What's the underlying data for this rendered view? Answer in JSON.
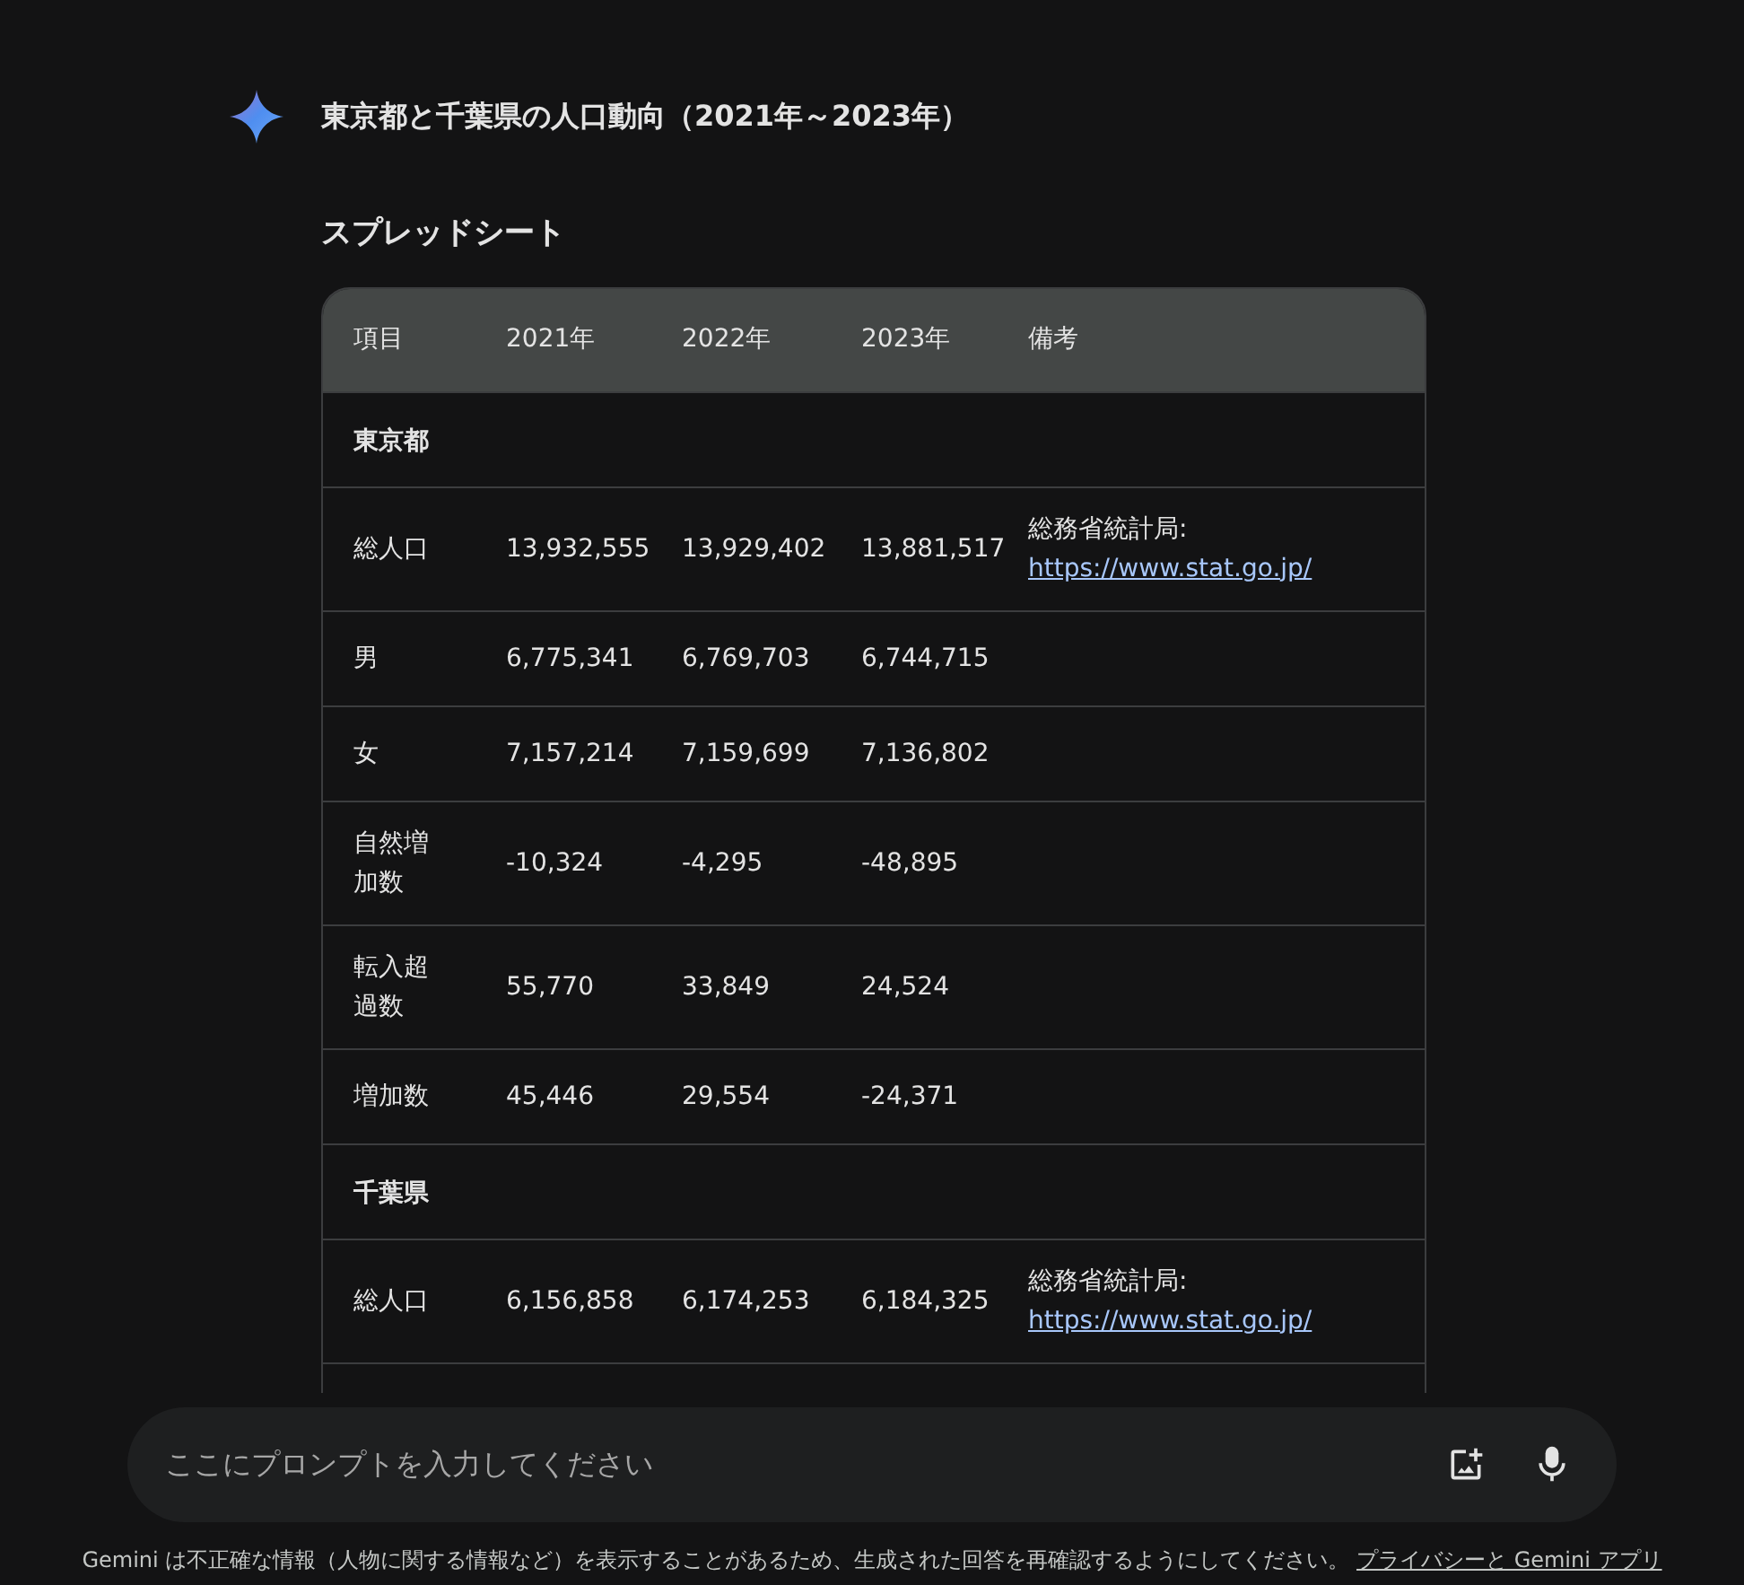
{
  "response": {
    "title": "東京都と千葉県の人口動向（2021年～2023年）",
    "section_heading": "スプレッドシート"
  },
  "table": {
    "columns": [
      "項目",
      "2021年",
      "2022年",
      "2023年",
      "備考"
    ],
    "rows": [
      {
        "kind": "section",
        "label": "東京都"
      },
      {
        "kind": "data",
        "label": "総人口",
        "values": [
          "13,932,555",
          "13,929,402",
          "13,881,517"
        ],
        "note": "総務省統計局:",
        "link": "https://www.stat.go.jp/"
      },
      {
        "kind": "data",
        "label": "男",
        "values": [
          "6,775,341",
          "6,769,703",
          "6,744,715"
        ]
      },
      {
        "kind": "data",
        "label": "女",
        "values": [
          "7,157,214",
          "7,159,699",
          "7,136,802"
        ]
      },
      {
        "kind": "data",
        "label": "自然増加数",
        "values": [
          "-10,324",
          "-4,295",
          "-48,895"
        ]
      },
      {
        "kind": "data",
        "label": "転入超過数",
        "values": [
          "55,770",
          "33,849",
          "24,524"
        ]
      },
      {
        "kind": "data",
        "label": "増加数",
        "values": [
          "45,446",
          "29,554",
          "-24,371"
        ]
      },
      {
        "kind": "section",
        "label": "千葉県"
      },
      {
        "kind": "data",
        "label": "総人口",
        "values": [
          "6,156,858",
          "6,174,253",
          "6,184,325"
        ],
        "note": "総務省統計局:",
        "link": "https://www.stat.go.jp/"
      }
    ]
  },
  "prompt": {
    "placeholder": "ここにプロンプトを入力してください"
  },
  "disclaimer": {
    "text": "Gemini は不正確な情報（人物に関する情報など）を表示することがあるため、生成された回答を再確認するようにしてください。",
    "link": "プライバシーと Gemini アプリ"
  }
}
